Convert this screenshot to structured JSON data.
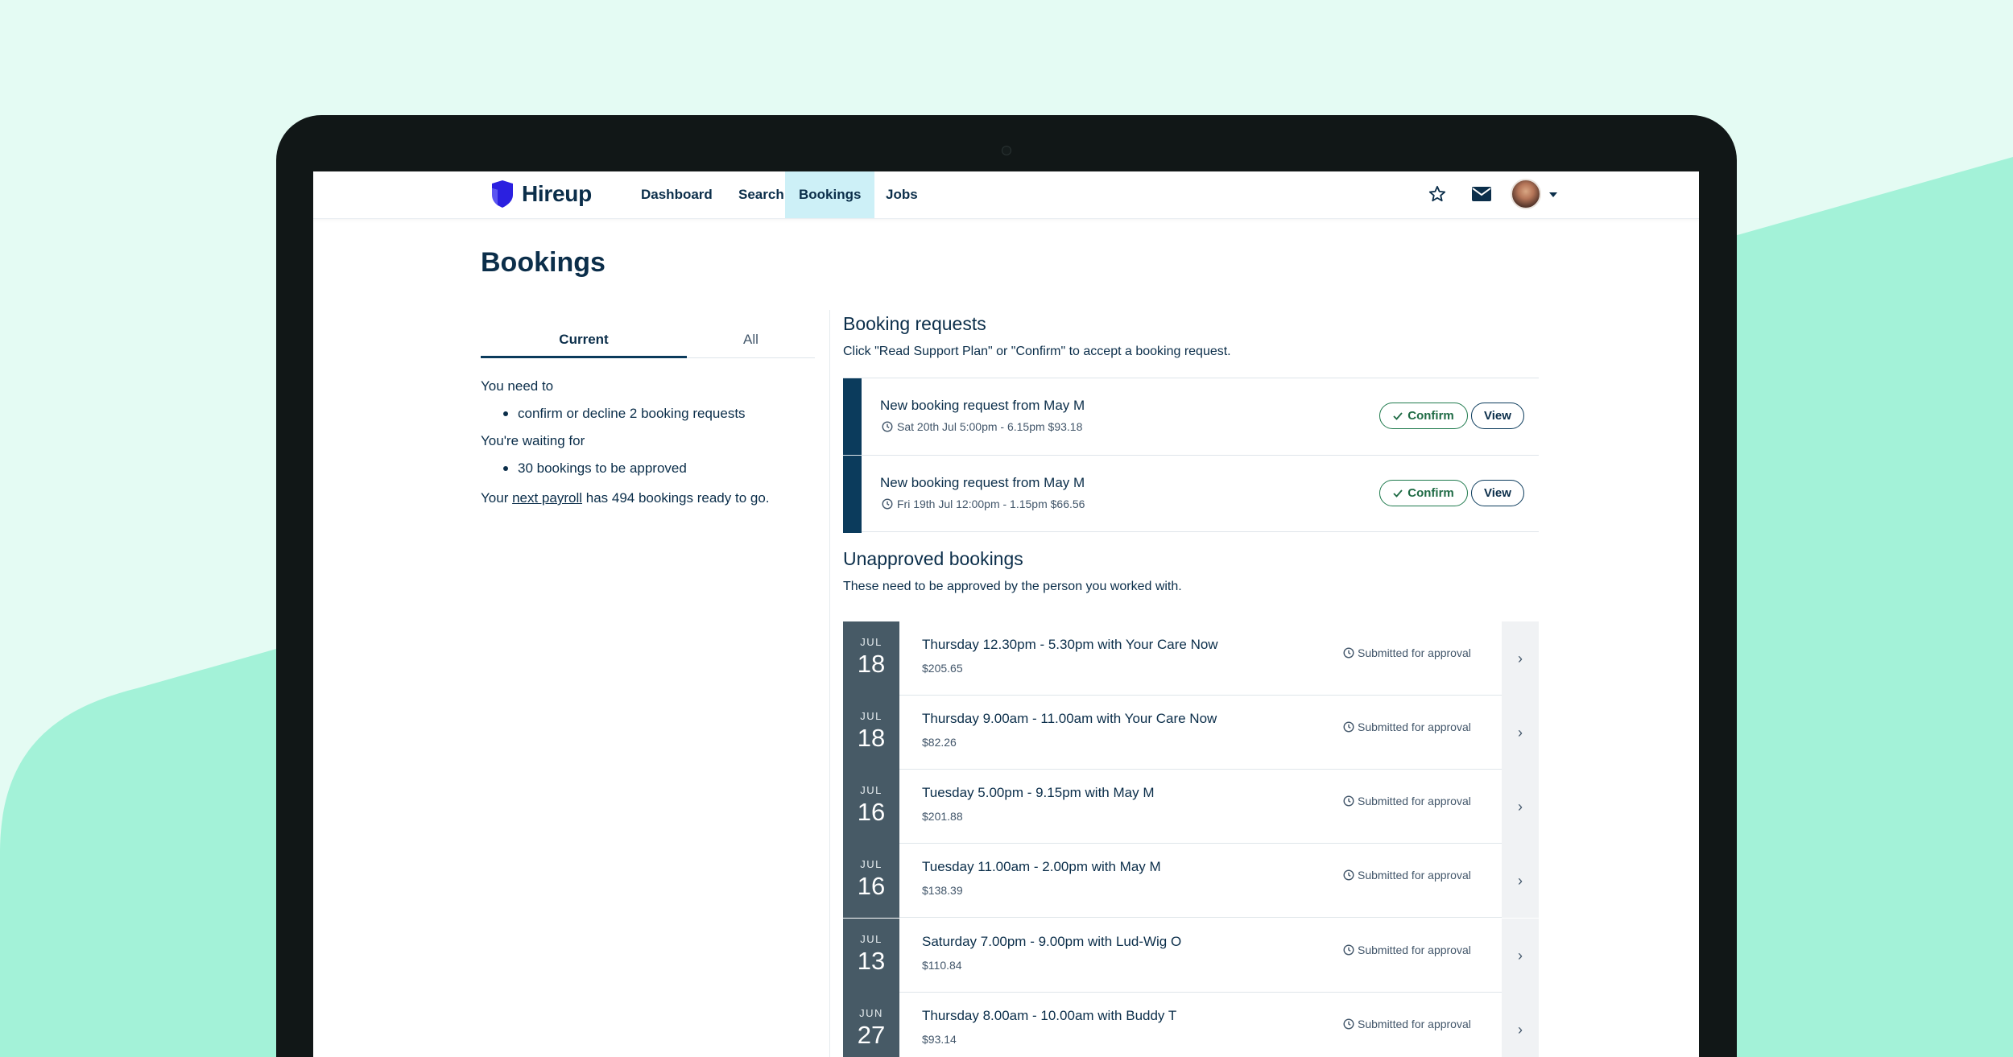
{
  "colors": {
    "background": "#e4fbf3",
    "accent_mint": "#a3f2d8",
    "brand_navy": "#0b2e4a",
    "logo_blue": "#2b20e0",
    "active_nav": "#cdf0f7",
    "confirm_green": "#1f7a4d",
    "date_box": "#475a66"
  },
  "brand": {
    "name": "Hireup"
  },
  "nav": {
    "items": [
      "Dashboard",
      "Search",
      "Bookings",
      "Jobs"
    ],
    "active": "Bookings",
    "icons": [
      "star-icon",
      "mail-icon",
      "avatar",
      "caret-down-icon"
    ]
  },
  "page": {
    "title": "Bookings"
  },
  "left": {
    "tabs": {
      "current": "Current",
      "all": "All"
    },
    "need_to_heading": "You need to",
    "need_to_item": "confirm or decline 2 booking requests",
    "waiting_heading": "You're waiting for",
    "waiting_item": "30 bookings to be approved",
    "payroll_prefix": "Your ",
    "payroll_link": "next payroll",
    "payroll_suffix": " has 494 bookings ready to go."
  },
  "requests": {
    "title": "Booking requests",
    "subtitle": "Click \"Read Support Plan\" or \"Confirm\" to accept a booking request.",
    "confirm_label": "Confirm",
    "view_label": "View",
    "items": [
      {
        "title": "New booking request from May M",
        "meta": "Sat 20th Jul 5:00pm - 6.15pm $93.18"
      },
      {
        "title": "New booking request from May M",
        "meta": "Fri 19th Jul 12:00pm - 1.15pm $66.56"
      }
    ]
  },
  "unapproved": {
    "title": "Unapproved bookings",
    "subtitle": "These need to be approved by the person you worked with.",
    "status_label": "Submitted for approval",
    "items": [
      {
        "month": "JUL",
        "day": "18",
        "title": "Thursday 12.30pm - 5.30pm with Your Care Now",
        "amount": "$205.65"
      },
      {
        "month": "JUL",
        "day": "18",
        "title": "Thursday 9.00am - 11.00am with Your Care Now",
        "amount": "$82.26"
      },
      {
        "month": "JUL",
        "day": "16",
        "title": "Tuesday 5.00pm - 9.15pm with May M",
        "amount": "$201.88"
      },
      {
        "month": "JUL",
        "day": "16",
        "title": "Tuesday 11.00am - 2.00pm with May M",
        "amount": "$138.39"
      },
      {
        "month": "JUL",
        "day": "13",
        "title": "Saturday 7.00pm - 9.00pm with Lud-Wig O",
        "amount": "$110.84"
      },
      {
        "month": "JUN",
        "day": "27",
        "title": "Thursday 8.00am - 10.00am with Buddy T",
        "amount": "$93.14"
      }
    ]
  }
}
